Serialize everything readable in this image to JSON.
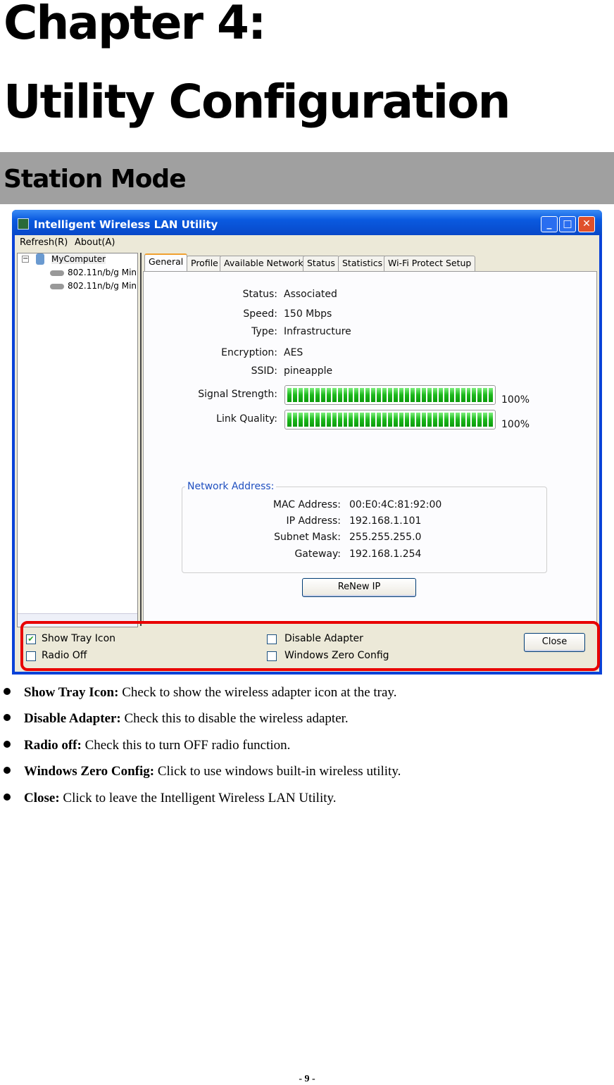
{
  "heading": {
    "chapter": "Chapter 4:",
    "title": "Utility Configuration",
    "section": "Station Mode"
  },
  "app": {
    "title": "Intelligent Wireless LAN Utility",
    "menu": [
      "Refresh(R)",
      "About(A)"
    ],
    "tree": {
      "root": "MyComputer",
      "adapters": [
        "802.11n/b/g Min",
        "802.11n/b/g Min"
      ]
    },
    "tabs": [
      "General",
      "Profile",
      "Available Network",
      "Status",
      "Statistics",
      "Wi-Fi Protect Setup"
    ],
    "active_tab": "General",
    "general": [
      {
        "label": "Status:",
        "value": "Associated"
      },
      {
        "label": "Speed:",
        "value": "150 Mbps"
      },
      {
        "label": "Type:",
        "value": "Infrastructure"
      },
      {
        "label": "Encryption:",
        "value": "AES"
      },
      {
        "label": "SSID:",
        "value": "pineapple"
      }
    ],
    "signal": {
      "label": "Signal Strength:",
      "percent": 100,
      "text": "100%"
    },
    "link": {
      "label": "Link Quality:",
      "percent": 100,
      "text": "100%"
    },
    "network": {
      "title": "Network Address:",
      "rows": [
        {
          "label": "MAC Address:",
          "value": "00:E0:4C:81:92:00"
        },
        {
          "label": "IP Address:",
          "value": "192.168.1.101"
        },
        {
          "label": "Subnet Mask:",
          "value": "255.255.255.0"
        },
        {
          "label": "Gateway:",
          "value": "192.168.1.254"
        }
      ]
    },
    "renew_label": "ReNew IP",
    "options": [
      {
        "label": "Show Tray Icon",
        "checked": true
      },
      {
        "label": "Radio Off",
        "checked": false
      },
      {
        "label": "Disable Adapter",
        "checked": false
      },
      {
        "label": "Windows Zero Config",
        "checked": false
      }
    ],
    "close_label": "Close",
    "highlight_color": "#e80000"
  },
  "bullets": [
    {
      "term": "Show Tray Icon:",
      "text": " Check to show the wireless adapter icon at the tray."
    },
    {
      "term": "Disable Adapter:",
      "text": " Check this to disable the wireless adapter."
    },
    {
      "term": "Radio off:",
      "text": " Check this to turn OFF radio function."
    },
    {
      "term": "Windows Zero Config:",
      "text": " Click to use windows built-in wireless utility."
    },
    {
      "term": "Close:",
      "text": " Click to leave the Intelligent Wireless LAN Utility."
    }
  ],
  "page_number": "- 9 -"
}
